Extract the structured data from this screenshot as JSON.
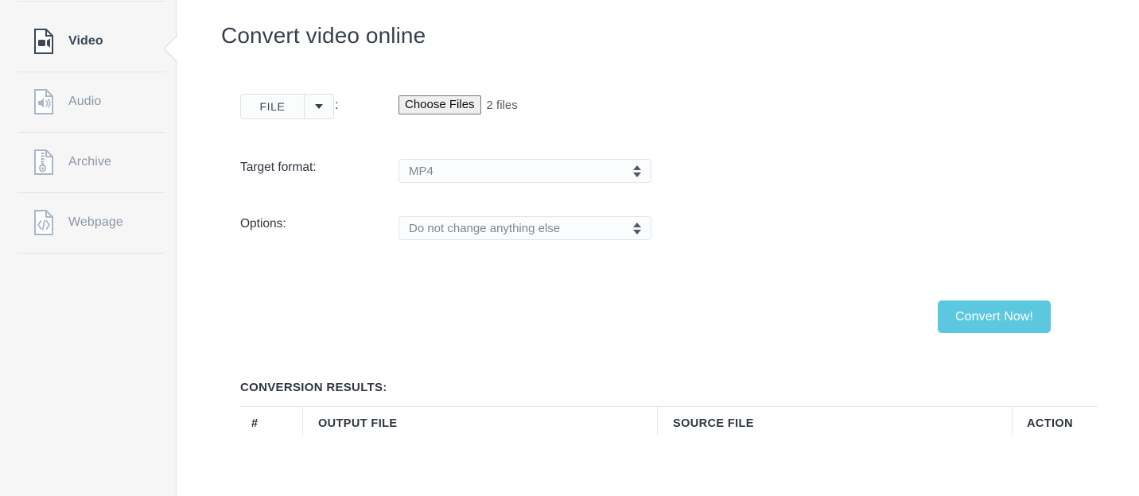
{
  "sidebar": {
    "items": [
      {
        "label": "Video",
        "icon": "video-file-icon",
        "active": true
      },
      {
        "label": "Audio",
        "icon": "audio-file-icon",
        "active": false
      },
      {
        "label": "Archive",
        "icon": "archive-file-icon",
        "active": false
      },
      {
        "label": "Webpage",
        "icon": "webpage-file-icon",
        "active": false
      }
    ]
  },
  "main": {
    "title": "Convert video online",
    "source_row": {
      "source_type_label": "FILE",
      "dropdown_icon": "chevron-down-icon",
      "colon": ":",
      "choose_files_label": "Choose Files",
      "file_count_text": "2 files"
    },
    "target_format": {
      "label": "Target format:",
      "value": "MP4"
    },
    "options": {
      "label": "Options:",
      "value": "Do not change anything else"
    },
    "convert_button": {
      "label": "Convert Now!",
      "color": "#5bc8e0"
    },
    "results": {
      "title": "CONVERSION RESULTS:",
      "columns": [
        "#",
        "OUTPUT FILE",
        "SOURCE FILE",
        "ACTION"
      ],
      "rows": []
    }
  },
  "colors": {
    "sidebar_bg": "#f6f6f7",
    "accent": "#5bc8e0",
    "text": "#2f3640",
    "muted": "#8b96a5"
  }
}
